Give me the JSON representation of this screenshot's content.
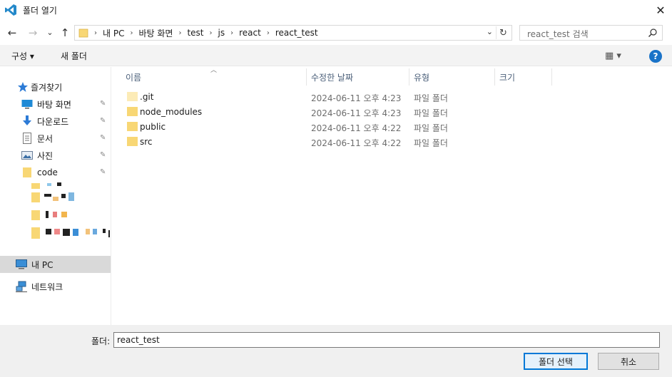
{
  "window": {
    "title": "폴더 열기",
    "close_glyph": "✕"
  },
  "nav": {
    "back": "←",
    "forward": "→",
    "recent": "⌄",
    "up": "↑"
  },
  "address": {
    "crumbs": [
      "내 PC",
      "바탕 화면",
      "test",
      "js",
      "react",
      "react_test"
    ],
    "separator": "›",
    "refresh": "↻",
    "dropdown": "⌄"
  },
  "search": {
    "placeholder": "react_test 검색"
  },
  "toolbar": {
    "organize_label": "구성 ▾",
    "new_folder_label": "새 폴더",
    "view_label": "▦ ▾",
    "help": "?"
  },
  "sidebar": {
    "quick_access": "즐겨찾기",
    "items": [
      {
        "label": "바탕 화면",
        "icon": "desktop-icon",
        "pinned": true
      },
      {
        "label": "다운로드",
        "icon": "download-icon",
        "pinned": true
      },
      {
        "label": "문서",
        "icon": "document-icon",
        "pinned": true
      },
      {
        "label": "사진",
        "icon": "pictures-icon",
        "pinned": true
      },
      {
        "label": "code",
        "icon": "folder-icon",
        "pinned": true
      }
    ],
    "this_pc": "내 PC",
    "network": "네트워크",
    "pin_glyph": "📌"
  },
  "columns": {
    "name": "이름",
    "date": "수정한 날짜",
    "type": "유형",
    "size": "크기"
  },
  "files": [
    {
      "name": ".git",
      "date": "2024-06-11 오후 4:23",
      "type": "파일 폴더",
      "hidden": true
    },
    {
      "name": "node_modules",
      "date": "2024-06-11 오후 4:23",
      "type": "파일 폴더",
      "hidden": false
    },
    {
      "name": "public",
      "date": "2024-06-11 오후 4:22",
      "type": "파일 폴더",
      "hidden": false
    },
    {
      "name": "src",
      "date": "2024-06-11 오후 4:22",
      "type": "파일 폴더",
      "hidden": false
    }
  ],
  "footer": {
    "folder_label": "폴더:",
    "folder_value": "react_test",
    "select_button": "폴더 선택",
    "cancel_button": "취소"
  },
  "colors": {
    "accent": "#0078d7",
    "folder": "#f8d775",
    "selected": "#d9d9d9"
  }
}
